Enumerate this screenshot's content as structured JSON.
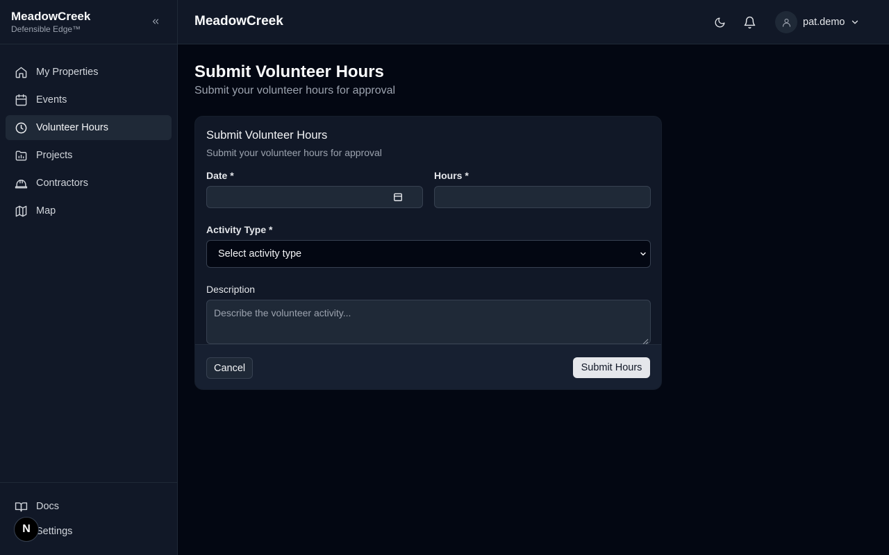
{
  "brand": {
    "name": "MeadowCreek",
    "tagline": "Defensible Edge™"
  },
  "sidebar": {
    "items": [
      {
        "label": "My Properties",
        "icon": "home-icon"
      },
      {
        "label": "Events",
        "icon": "calendar-icon"
      },
      {
        "label": "Volunteer Hours",
        "icon": "clock-icon",
        "active": true
      },
      {
        "label": "Projects",
        "icon": "folder-chart-icon"
      },
      {
        "label": "Contractors",
        "icon": "hard-hat-icon"
      },
      {
        "label": "Map",
        "icon": "map-icon"
      }
    ],
    "footer": [
      {
        "label": "Docs",
        "icon": "book-icon"
      },
      {
        "label": "Settings",
        "icon": "gear-icon"
      }
    ]
  },
  "header": {
    "title": "MeadowCreek",
    "user": "pat.demo"
  },
  "page": {
    "title": "Submit Volunteer Hours",
    "subtitle": "Submit your volunteer hours for approval"
  },
  "form": {
    "title": "Submit Volunteer Hours",
    "subtitle": "Submit your volunteer hours for approval",
    "date_label": "Date *",
    "date_value": "",
    "hours_label": "Hours *",
    "hours_value": "",
    "activity_label": "Activity Type *",
    "activity_selected": "Select activity type",
    "description_label": "Description",
    "description_placeholder": "Describe the volunteer activity...",
    "cancel_label": "Cancel",
    "submit_label": "Submit Hours"
  },
  "badge": {
    "letter": "N"
  },
  "colors": {
    "background": "#030712",
    "panel": "#111827",
    "border": "#1f2937",
    "accent": "#e5e7eb"
  }
}
